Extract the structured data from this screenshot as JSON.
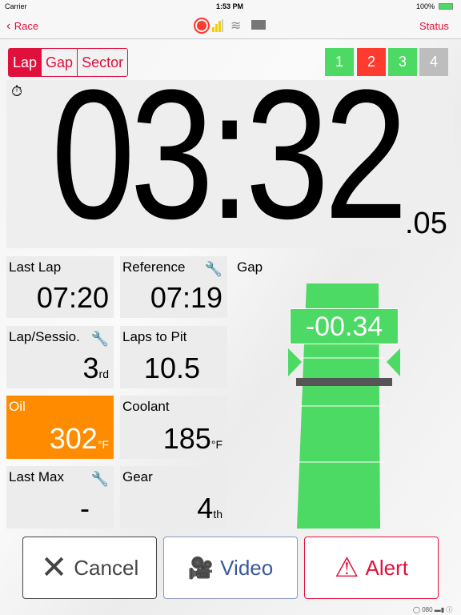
{
  "status_bar": {
    "carrier": "Carrier",
    "time": "1:53 PM",
    "battery": "100%"
  },
  "nav": {
    "back_label": "Race",
    "right_label": "Status"
  },
  "mode_tabs": [
    {
      "label": "Lap",
      "selected": true
    },
    {
      "label": "Gap",
      "selected": false
    },
    {
      "label": "Sector",
      "selected": false
    }
  ],
  "sectors": [
    {
      "label": "1",
      "color": "#4cd964"
    },
    {
      "label": "2",
      "color": "#ff3b30"
    },
    {
      "label": "3",
      "color": "#4cd964"
    },
    {
      "label": "4",
      "color": "#bdbdbd"
    }
  ],
  "timer": {
    "main": "03:32",
    "fraction": ".05"
  },
  "tiles": {
    "last_lap": {
      "label": "Last Lap",
      "value": "07:20"
    },
    "reference": {
      "label": "Reference",
      "value": "07:19"
    },
    "lap_session": {
      "label": "Lap/Sessio.",
      "value": "3",
      "suffix": "rd"
    },
    "laps_to_pit": {
      "label": "Laps to Pit",
      "value": "10.5"
    },
    "oil": {
      "label": "Oil",
      "value": "302",
      "unit": "°F",
      "color": "#ff8c00"
    },
    "coolant": {
      "label": "Coolant",
      "value": "185",
      "unit": "°F"
    },
    "last_max": {
      "label": "Last Max",
      "value": "-"
    },
    "gear": {
      "label": "Gear",
      "value": "4",
      "suffix": "th"
    }
  },
  "gap": {
    "label": "Gap",
    "value": "-00.34",
    "color": "#4cd964"
  },
  "buttons": {
    "cancel": "Cancel",
    "video": "Video",
    "alert": "Alert"
  },
  "footer": {
    "text": "080"
  }
}
